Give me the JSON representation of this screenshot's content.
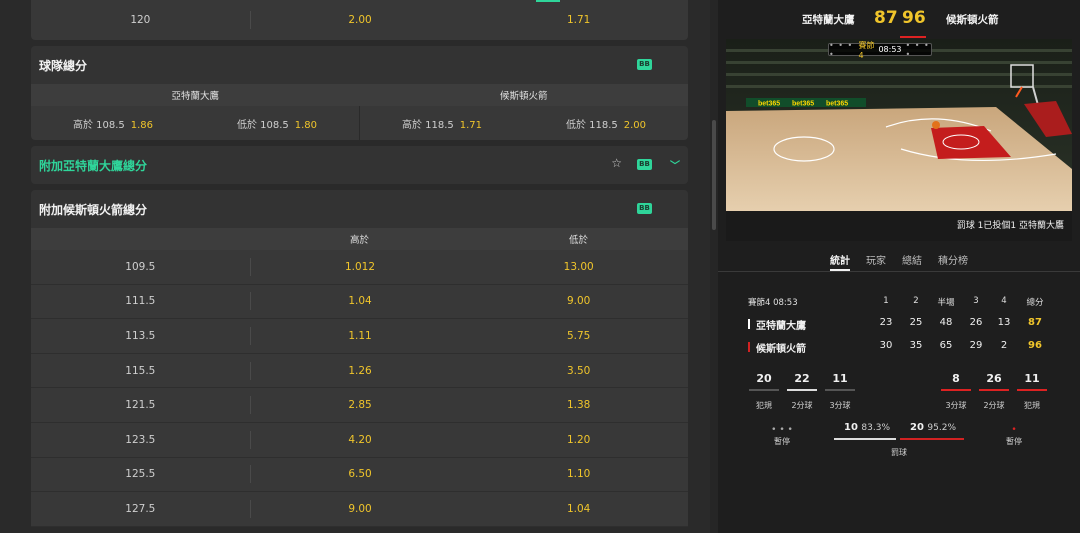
{
  "top_row": {
    "line": "120",
    "over": "2.00",
    "under": "1.71"
  },
  "team_totals": {
    "title": "球隊總分",
    "badge": "BB",
    "team_a": "亞特蘭大鷹",
    "team_b": "候斯頓火箭",
    "cells": [
      {
        "label": "高於 108.5",
        "odd": "1.86"
      },
      {
        "label": "低於 108.5",
        "odd": "1.80"
      },
      {
        "label": "高於 118.5",
        "odd": "1.71"
      },
      {
        "label": "低於 118.5",
        "odd": "2.00"
      }
    ]
  },
  "extra_atlanta": {
    "title": "附加亞特蘭大鷹總分",
    "badge": "BB",
    "star_icon": "star-outline-icon",
    "chevron_icon": "chevron-down-icon"
  },
  "extra_houston": {
    "title": "附加候斯頓火箭總分",
    "badge": "BB",
    "col_over": "高於",
    "col_under": "低於",
    "rows": [
      {
        "line": "109.5",
        "over": "1.012",
        "under": "13.00"
      },
      {
        "line": "111.5",
        "over": "1.04",
        "under": "9.00"
      },
      {
        "line": "113.5",
        "over": "1.11",
        "under": "5.75"
      },
      {
        "line": "115.5",
        "over": "1.26",
        "under": "3.50"
      },
      {
        "line": "121.5",
        "over": "2.85",
        "under": "1.38"
      },
      {
        "line": "123.5",
        "over": "4.20",
        "under": "1.20"
      },
      {
        "line": "125.5",
        "over": "6.50",
        "under": "1.10"
      },
      {
        "line": "127.5",
        "over": "9.00",
        "under": "1.04"
      }
    ]
  },
  "scoreboard": {
    "team_a": "亞特蘭大鷹",
    "team_b": "候斯頓火箭",
    "score_a": "87",
    "score_b": "96"
  },
  "video": {
    "period_label": "賽節4",
    "clock": "08:53",
    "dots_left": "• • • •",
    "dots_right": "• • • •",
    "caption": "罰球 1已投個1 亞特蘭大鷹",
    "ad_text": "bet365"
  },
  "tabs": [
    "統計",
    "玩家",
    "總結",
    "積分榜"
  ],
  "stats": {
    "period_time": "賽節4 08:53",
    "headers": [
      "1",
      "2",
      "半場",
      "3",
      "4",
      "總分"
    ],
    "team_a": {
      "name": "亞特蘭大鷹",
      "q": [
        "23",
        "25",
        "48",
        "26",
        "13",
        "87"
      ],
      "bar_color": "#ffffff"
    },
    "team_b": {
      "name": "候斯頓火箭",
      "q": [
        "30",
        "35",
        "65",
        "29",
        "2",
        "96"
      ],
      "bar_color": "#d22222"
    },
    "left_box": [
      {
        "value": "20",
        "label": "犯規"
      },
      {
        "value": "22",
        "label": "2分球"
      },
      {
        "value": "11",
        "label": "3分球"
      }
    ],
    "right_box": [
      {
        "value": "8",
        "label": "3分球"
      },
      {
        "value": "26",
        "label": "2分球"
      },
      {
        "value": "11",
        "label": "犯規"
      }
    ],
    "timeout_label": "暫停",
    "free_throws": {
      "label": "罰球",
      "a_made": "10",
      "a_pct": "83.3%",
      "b_made": "20",
      "b_pct": "95.2%"
    }
  }
}
